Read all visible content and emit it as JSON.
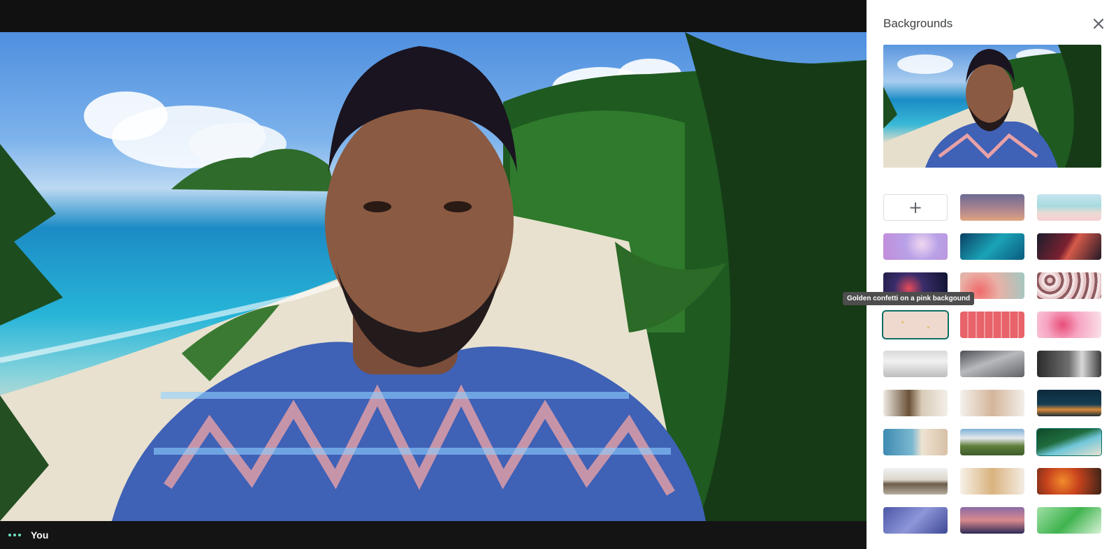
{
  "participant": {
    "name": "You",
    "menu_icon": "more-horiz-icon"
  },
  "panel": {
    "title": "Backgrounds",
    "close_icon": "close-icon",
    "add_icon": "plus-icon",
    "add_label": "+"
  },
  "tooltip": {
    "text": "Golden confetti on a pink backgound"
  },
  "colors": {
    "accent": "#0b6e62",
    "panel_bg": "#ffffff",
    "bar_bg": "#141414",
    "dots": "#6fe3c6"
  }
}
